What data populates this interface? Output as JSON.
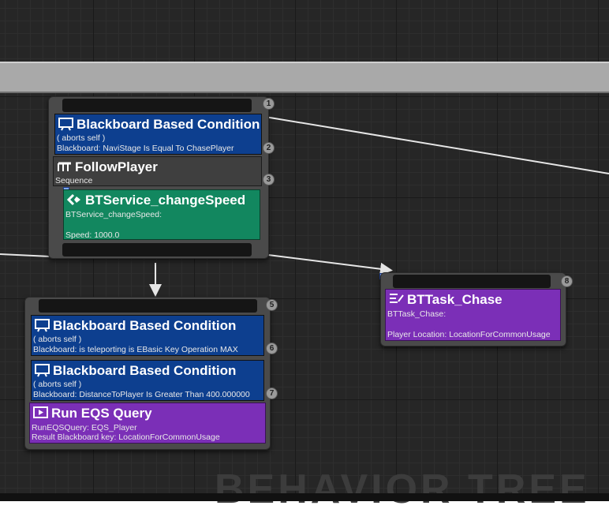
{
  "canvas": {
    "watermark": "BEHAVIOR TREE"
  },
  "nodes": {
    "selector_top": {
      "index_top": "1",
      "deco1": {
        "title": "Blackboard Based Condition",
        "line1": "( aborts self )",
        "line2": "Blackboard: NaviStage Is Equal To ChasePlayer",
        "index": "2"
      },
      "composite": {
        "title": "FollowPlayer",
        "type": "Sequence",
        "index": "3"
      },
      "service": {
        "title": "BTService_changeSpeed",
        "line1": "BTService_changeSpeed:",
        "line2": "Speed: 1000.0"
      }
    },
    "eqs_node": {
      "index_top": "5",
      "deco1": {
        "title": "Blackboard Based Condition",
        "line1": "( aborts self )",
        "line2": "Blackboard: is teleporting is EBasic Key Operation MAX",
        "index": "6"
      },
      "deco2": {
        "title": "Blackboard Based Condition",
        "line1": "( aborts self )",
        "line2": "Blackboard: DistanceToPlayer Is Greater Than 400.000000",
        "index": "7"
      },
      "task": {
        "title": "Run EQS Query",
        "line1": "RunEQSQuery: EQS_Player",
        "line2": "Result Blackboard key: LocationForCommonUsage"
      }
    },
    "chase_node": {
      "index_top": "8",
      "task": {
        "title": "BTTask_Chase",
        "line1": "BTTask_Chase:",
        "line2": "Player Location: LocationForCommonUsage"
      }
    }
  },
  "icons": {
    "decorator": "monitor-icon",
    "composite": "sequence-icon",
    "service": "service-arrows-icon",
    "task": "task-list-icon",
    "eqs": "eqs-play-icon"
  },
  "colors": {
    "decorator": "#0d3f8f",
    "composite": "#3f3f3f",
    "service": "#12875f",
    "task": "#7b2fb7",
    "wire": "#e6e6e6"
  }
}
